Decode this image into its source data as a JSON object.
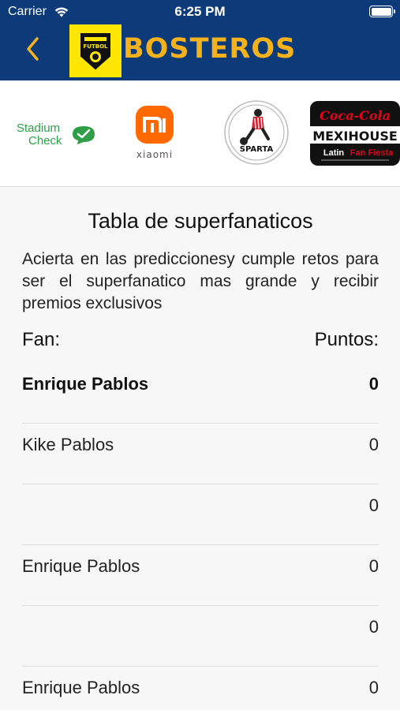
{
  "status_bar": {
    "carrier": "Carrier",
    "time": "6:25 PM"
  },
  "header": {
    "brand": "BOSTEROS",
    "logo_text": "FUTBOL"
  },
  "sponsors": {
    "stadium_check": {
      "line1": "Stadium",
      "line2": "Check"
    },
    "xiaomi": {
      "label": "xiaomi"
    },
    "sparta": {
      "label": "SPARTA"
    },
    "mexihouse": {
      "top": "Coca-Cola",
      "middle": "MEXIHOUSE",
      "bottom_a": "Latin",
      "bottom_b": "Fan Fiesta"
    }
  },
  "leaderboard": {
    "title": "Tabla de superfanaticos",
    "description": "Acierta en las prediccionesy cumple retos para ser el superfanatico mas grande y recibir premios exclusivos",
    "col_fan": "Fan:",
    "col_points": "Puntos:",
    "rows": [
      {
        "name": "Enrique Pablos",
        "points": "0"
      },
      {
        "name": "Kike Pablos",
        "points": "0"
      },
      {
        "name": "",
        "points": "0"
      },
      {
        "name": "Enrique Pablos",
        "points": "0"
      },
      {
        "name": "",
        "points": "0"
      },
      {
        "name": "Enrique Pablos",
        "points": "0"
      }
    ]
  },
  "colors": {
    "header_bg": "#0d3a78",
    "brand": "#f5b21b",
    "logo_bg": "#ffe600",
    "stadium_green": "#2e9e47",
    "xiaomi_orange": "#ff6900",
    "coca_red": "#e3001b"
  }
}
